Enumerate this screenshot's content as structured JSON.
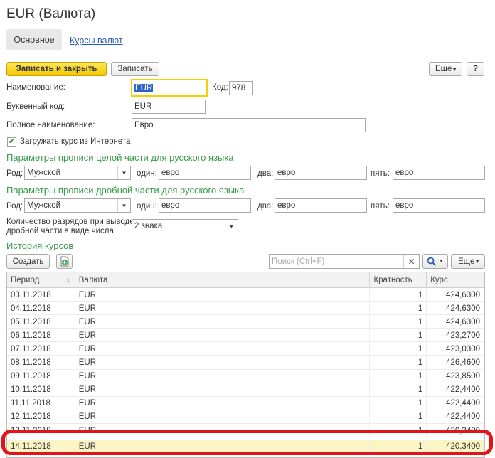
{
  "window": {
    "title": "EUR (Валюта)"
  },
  "tabs": {
    "main": "Основное",
    "rates": "Курсы валют"
  },
  "toolbar": {
    "save_close": "Записать и закрыть",
    "save": "Записать",
    "more": "Еще",
    "help": "?"
  },
  "form": {
    "name_label": "Наименование:",
    "name_value": "EUR",
    "code_label": "Код:",
    "code_value": "978",
    "letter_code_label": "Буквенный код:",
    "letter_code_value": "EUR",
    "full_name_label": "Полное наименование:",
    "full_name_value": "Евро",
    "load_rate_label": "Загружать курс из Интернета",
    "load_rate_checked": true
  },
  "spelling_int": {
    "heading": "Параметры прописи целой части для русского языка",
    "gender_label": "Род:",
    "gender_value": "Мужской",
    "one_label": "один:",
    "one_value": "евро",
    "two_label": "два:",
    "two_value": "евро",
    "five_label": "пять:",
    "five_value": "евро"
  },
  "spelling_frac": {
    "heading": "Параметры прописи дробной части для русского языка",
    "gender_label": "Род:",
    "gender_value": "Мужской",
    "one_label": "один:",
    "one_value": "евро",
    "two_label": "два:",
    "two_value": "евро",
    "five_label": "пять:",
    "five_value": "евро"
  },
  "digits": {
    "label_line1": "Количество разрядов при выводе",
    "label_line2": "дробной части в виде числа:",
    "value": "2 знака"
  },
  "history": {
    "heading": "История курсов",
    "create": "Создать",
    "search_placeholder": "Поиск (Ctrl+F)",
    "more": "Еще",
    "columns": {
      "period": "Период",
      "currency": "Валюта",
      "multiplicity": "Кратность",
      "rate": "Курс"
    },
    "rows": [
      {
        "period": "03.11.2018",
        "currency": "EUR",
        "mult": "1",
        "rate": "424,6300"
      },
      {
        "period": "04.11.2018",
        "currency": "EUR",
        "mult": "1",
        "rate": "424,6300"
      },
      {
        "period": "05.11.2018",
        "currency": "EUR",
        "mult": "1",
        "rate": "424,6300"
      },
      {
        "period": "06.11.2018",
        "currency": "EUR",
        "mult": "1",
        "rate": "423,2700"
      },
      {
        "period": "07.11.2018",
        "currency": "EUR",
        "mult": "1",
        "rate": "423,0300"
      },
      {
        "period": "08.11.2018",
        "currency": "EUR",
        "mult": "1",
        "rate": "426,4600"
      },
      {
        "period": "09.11.2018",
        "currency": "EUR",
        "mult": "1",
        "rate": "423,8500"
      },
      {
        "period": "10.11.2018",
        "currency": "EUR",
        "mult": "1",
        "rate": "422,4400"
      },
      {
        "period": "11.11.2018",
        "currency": "EUR",
        "mult": "1",
        "rate": "422,4400"
      },
      {
        "period": "12.11.2018",
        "currency": "EUR",
        "mult": "1",
        "rate": "422,4400"
      },
      {
        "period": "13.11.2018",
        "currency": "EUR",
        "mult": "1",
        "rate": "420,3400"
      },
      {
        "period": "14.11.2018",
        "currency": "EUR",
        "mult": "1",
        "rate": "420,3400"
      }
    ]
  },
  "colors": {
    "accent_yellow": "#f4c800",
    "section_green": "#3a9a4a",
    "highlight_red": "#e0141a",
    "link_blue": "#2a5db0"
  }
}
